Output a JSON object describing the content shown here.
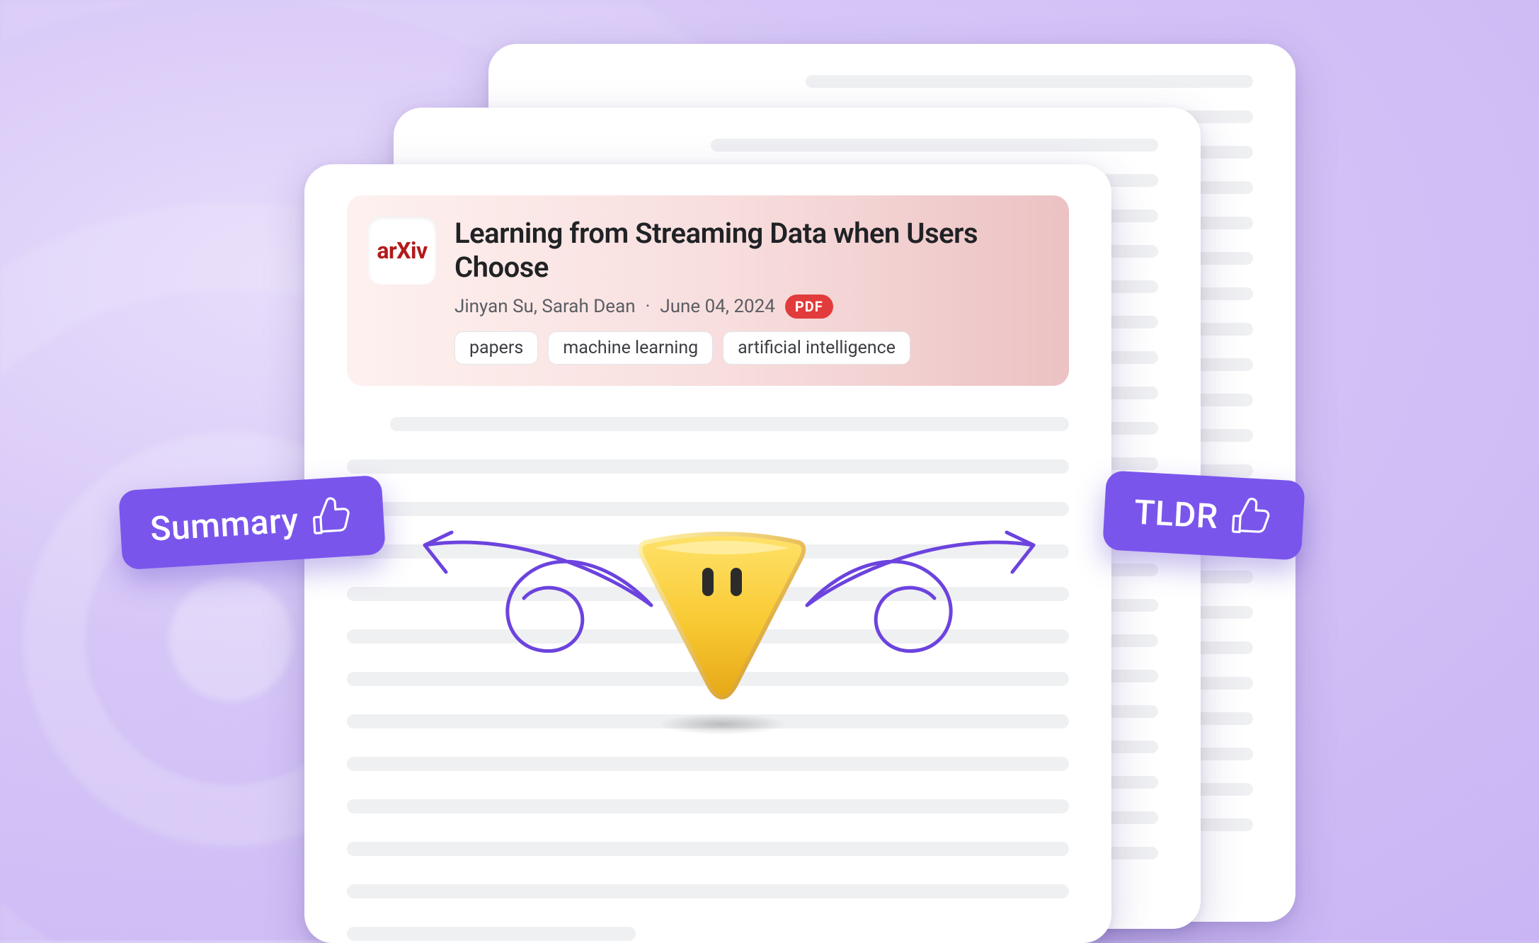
{
  "source_badge": "arXiv",
  "paper": {
    "title": "Learning from Streaming Data when Users Choose",
    "authors": "Jinyan Su, Sarah Dean",
    "date": "June 04, 2024",
    "dot": " · ",
    "filetype_badge": "PDF",
    "tags": [
      "papers",
      "machine learning",
      "artificial intelligence"
    ]
  },
  "chips": {
    "summary": "Summary",
    "tldr": "TLDR"
  }
}
